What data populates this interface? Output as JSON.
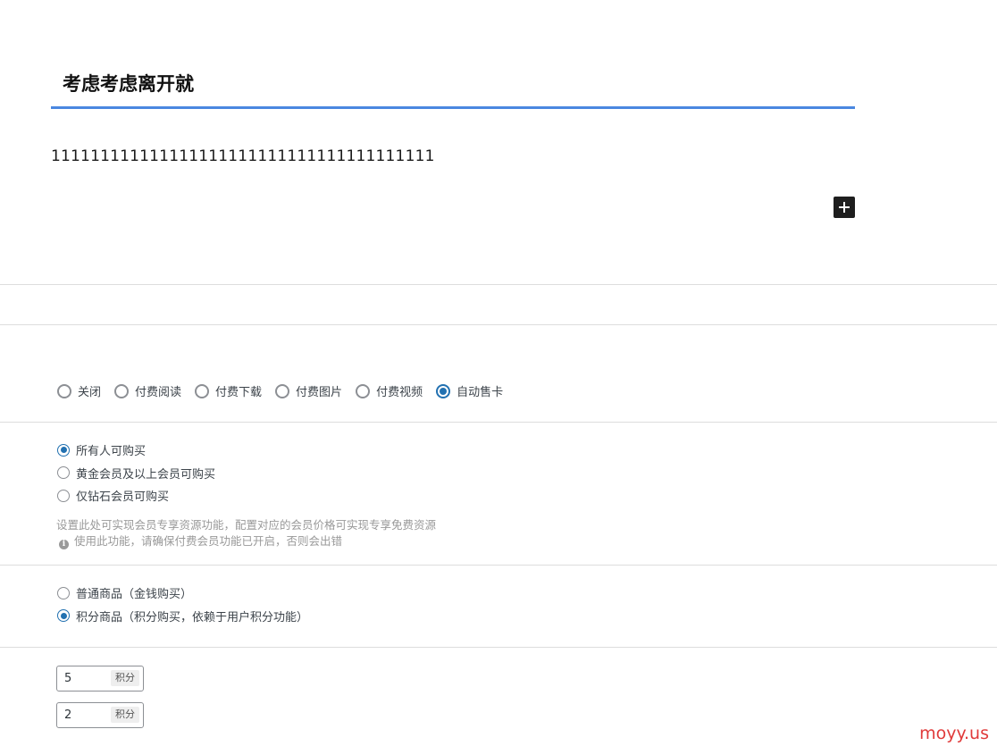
{
  "post": {
    "title": "考虑考虑离开就",
    "content": "111111111111111111111111111111111111111"
  },
  "pay_type": {
    "options": [
      {
        "label": "关闭",
        "checked": false
      },
      {
        "label": "付费阅读",
        "checked": false
      },
      {
        "label": "付费下载",
        "checked": false
      },
      {
        "label": "付费图片",
        "checked": false
      },
      {
        "label": "付费视频",
        "checked": false
      },
      {
        "label": "自动售卡",
        "checked": true
      }
    ]
  },
  "buyer_scope": {
    "options": [
      {
        "label": "所有人可购买",
        "checked": true
      },
      {
        "label": "黄金会员及以上会员可购买",
        "checked": false
      },
      {
        "label": "仅钻石会员可购买",
        "checked": false
      }
    ],
    "hint": "设置此处可实现会员专享资源功能，配置对应的会员价格可实现专享免费资源",
    "warning": "使用此功能，请确保付费会员功能已开启，否则会出错"
  },
  "product_type": {
    "options": [
      {
        "label": "普通商品（金钱购买）",
        "checked": false
      },
      {
        "label": "积分商品（积分购买，依赖于用户积分功能）",
        "checked": true
      }
    ]
  },
  "points": {
    "price_value": "5",
    "member_price_value": "2",
    "unit": "积分"
  },
  "watermark": "moyy.us",
  "colors": {
    "accent": "#4a87e0",
    "radio_checked": "#2271b1",
    "watermark": "#e03a3a"
  }
}
